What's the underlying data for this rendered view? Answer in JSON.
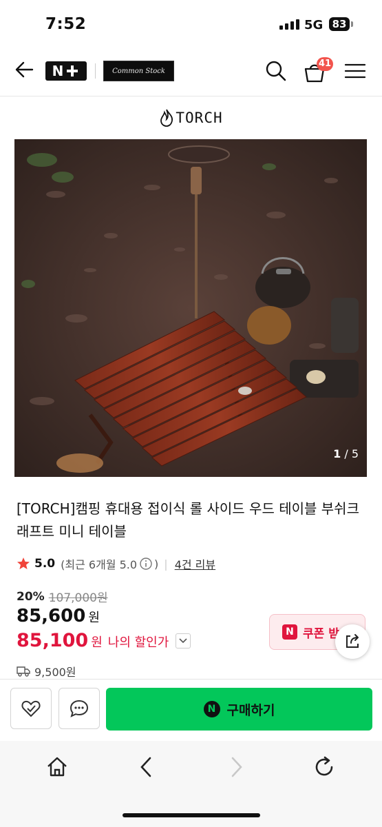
{
  "status": {
    "time": "7:52",
    "network": "5G",
    "battery": "83"
  },
  "header": {
    "store_logo_text": "Common Stock",
    "cart_count": "41",
    "plus_label": "N+"
  },
  "brand": {
    "name": "TORCH"
  },
  "gallery": {
    "current": "1",
    "total": "/ 5"
  },
  "product": {
    "title": "[TORCH]캠핑 휴대용 접이식 롤 사이드 우드 테이블 부쉬크래프트 미니 테이블",
    "rating": "5.0",
    "recent_rating": "(최근 6개월 5.0",
    "review_link": "4건 리뷰",
    "discount_pct": "20%",
    "original_price": "107,000원",
    "price": "85,600",
    "price_unit": "원",
    "my_price": "85,100",
    "my_price_unit": "원",
    "my_price_label": "나의 할인가",
    "coupon_label": "쿠폰 받",
    "shipping_fee": "9,500원"
  },
  "actions": {
    "buy_label": "구매하기"
  },
  "colors": {
    "accent_green": "#03c75a",
    "sale_red": "#e0153d",
    "star": "#f0443a"
  }
}
